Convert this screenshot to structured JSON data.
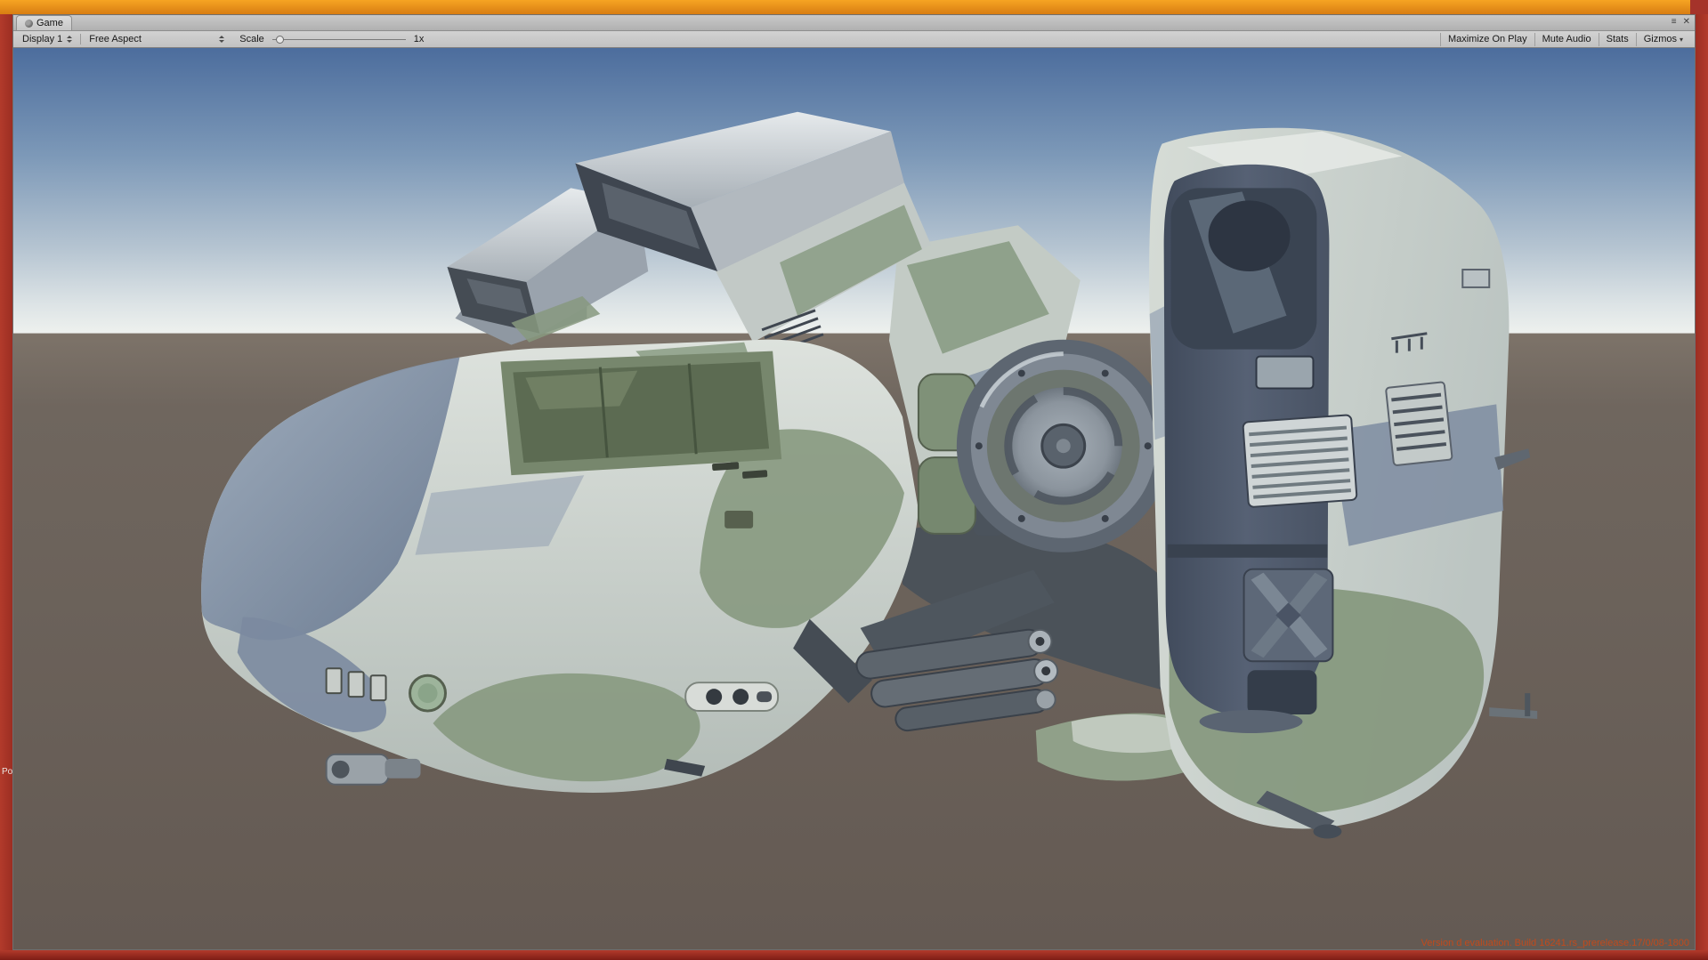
{
  "window": {
    "tab_label": "Game",
    "menu_icon": "≡",
    "close_icon": "✕"
  },
  "toolbar": {
    "display": "Display 1",
    "aspect": "Free Aspect",
    "scale_label": "Scale",
    "scale_value": "1x",
    "maximize_on_play": "Maximize On Play",
    "mute_audio": "Mute Audio",
    "stats": "Stats",
    "gizmos": "Gizmos",
    "gizmos_caret": "▾"
  },
  "viewport": {
    "watermark": "Version d evaluation. Build 16241.rs_prerelease.17/0/08-1800",
    "edge_label": "Po"
  },
  "colors": {
    "frame_orange": "#ED8F1C",
    "frame_red": "#AC3026",
    "sky_top": "#4C6D9D",
    "sky_horizon": "#EEF1EE",
    "ground": "#6E645C",
    "watermark_text": "#C14A1C",
    "camo_green": "#87997F",
    "camo_blue_gray": "#7B89A0",
    "camo_light": "#D0D7D1"
  }
}
